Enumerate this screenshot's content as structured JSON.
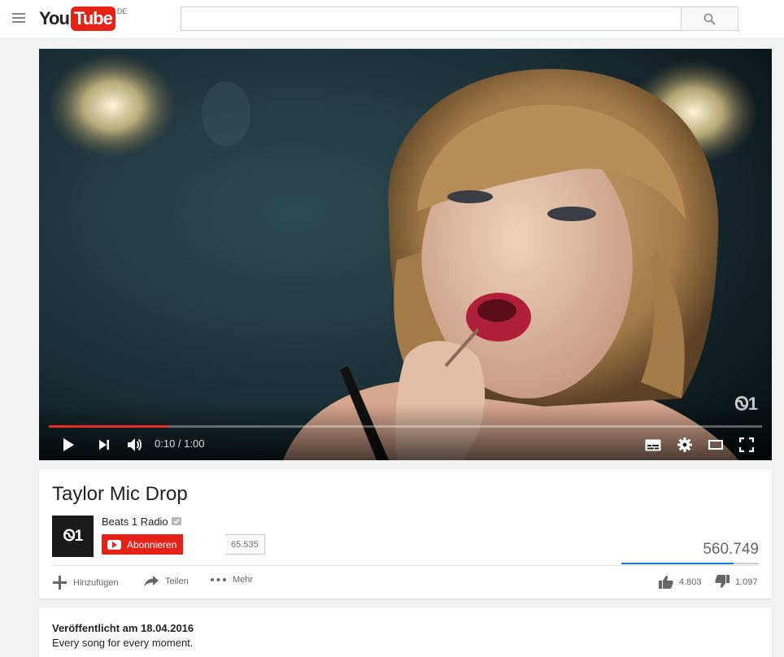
{
  "masthead": {
    "logo_you": "You",
    "logo_tube": "Tube",
    "region": "DE",
    "search_placeholder": ""
  },
  "player": {
    "watermark": "Ꮻ1",
    "time_display": "0:10 / 1:00",
    "progress_fraction": 0.168
  },
  "video": {
    "title": "Taylor Mic Drop",
    "channel_name": "Beats 1 Radio",
    "channel_avatar_text": "Ꮻ1",
    "subscribe_label": "Abonnieren",
    "subscriber_count": "65.535",
    "view_count": "560.749",
    "likes": "4.803",
    "dislikes": "1.097",
    "like_fraction": 0.814
  },
  "actions": {
    "add_label": "Hinzufügen",
    "share_label": "Teilen",
    "more_label": "Mehr"
  },
  "description": {
    "published": "Veröffentlicht am 18.04.2016",
    "text": "Every song for every moment."
  },
  "colors": {
    "brand_red": "#e62117",
    "progress_red": "#e52d27",
    "like_blue": "#167ac6"
  }
}
